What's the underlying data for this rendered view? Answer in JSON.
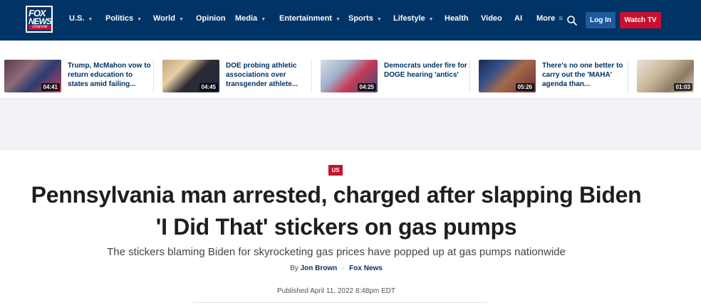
{
  "brand": {
    "logo_line1": "FOX",
    "logo_line2": "NEWS",
    "logo_line3": "channel",
    "primary_color": "#003366",
    "accent_color": "#c8102e"
  },
  "nav": {
    "items": [
      {
        "label": "U.S.",
        "dropdown": true
      },
      {
        "label": "Politics",
        "dropdown": true
      },
      {
        "label": "World",
        "dropdown": true
      },
      {
        "label": "Opinion",
        "dropdown": false
      },
      {
        "label": "Media",
        "dropdown": true
      },
      {
        "label": "Entertainment",
        "dropdown": true
      },
      {
        "label": "Sports",
        "dropdown": true
      },
      {
        "label": "Lifestyle",
        "dropdown": true
      },
      {
        "label": "Health",
        "dropdown": false
      },
      {
        "label": "Video",
        "dropdown": false
      },
      {
        "label": "AI",
        "dropdown": false
      },
      {
        "label": "More",
        "dropdown": true
      }
    ],
    "caret_glyph": "▼",
    "more_glyph": "≡",
    "search_icon": "search-icon",
    "login_label": "Log In",
    "watch_label": "Watch TV"
  },
  "video_strip": [
    {
      "title": "Trump, McMahon vow to return education to states amid failing...",
      "duration": "04:41"
    },
    {
      "title": "DOE probing athletic associations over transgender athlete...",
      "duration": "04:45"
    },
    {
      "title": "Democrats under fire for DOGE hearing 'antics'",
      "duration": "04:25"
    },
    {
      "title": "There's no one better to carry out the 'MAHA' agenda than...",
      "duration": "05:26"
    },
    {
      "title": "",
      "duration": "01:03"
    }
  ],
  "article": {
    "category": "US",
    "headline_line1": "Pennsylvania man arrested, charged after slapping Biden",
    "headline_line2": "'I Did That' stickers on gas pumps",
    "subheadline": "The stickers blaming Biden for skyrocketing gas prices have popped up at gas pumps nationwide",
    "byline_prefix": "By",
    "author": "Jon Brown",
    "byline_separator": "·",
    "outlet": "Fox News",
    "published": "Published April 11, 2022 8:48pm EDT"
  }
}
